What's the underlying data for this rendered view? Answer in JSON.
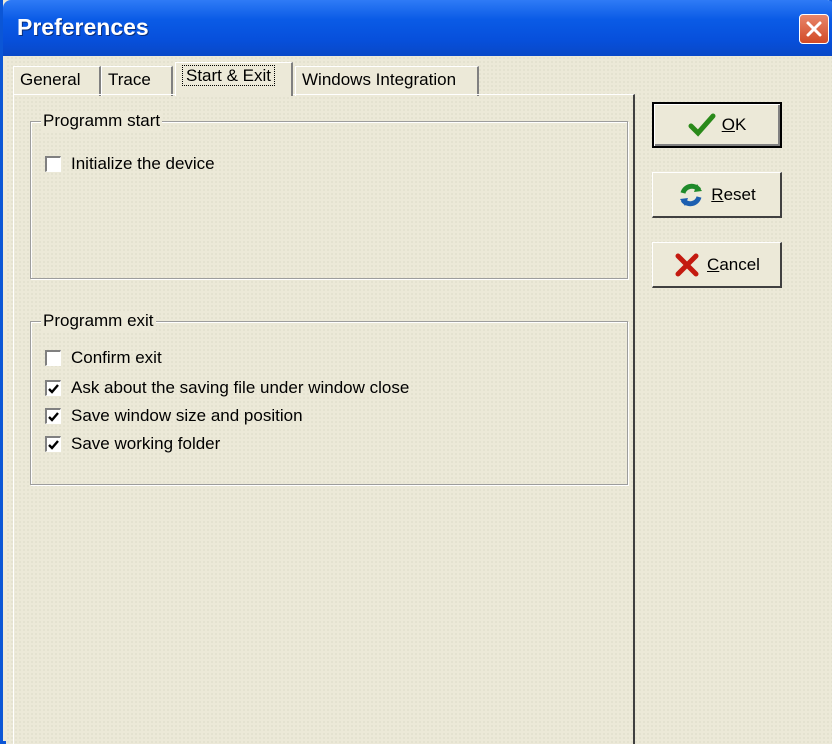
{
  "window": {
    "title": "Preferences"
  },
  "tabs": [
    {
      "label": "General"
    },
    {
      "label": "Trace"
    },
    {
      "label": "Start & Exit"
    },
    {
      "label": "Windows Integration"
    }
  ],
  "groups": {
    "start": {
      "title": "Programm start",
      "items": [
        {
          "label": "Initialize the device",
          "checked": false
        }
      ]
    },
    "exit": {
      "title": "Programm exit",
      "items": [
        {
          "label": "Confirm exit",
          "checked": false
        },
        {
          "label": "Ask about the saving file under window close",
          "checked": true
        },
        {
          "label": "Save window size and position",
          "checked": true
        },
        {
          "label": "Save working folder",
          "checked": true
        }
      ]
    }
  },
  "buttons": {
    "ok": {
      "label": "OK",
      "mnemonic": "O",
      "rest": "K",
      "icon": "checkmark-icon"
    },
    "reset": {
      "label": "Reset",
      "mnemonic": "R",
      "rest": "eset",
      "icon": "refresh-icon"
    },
    "cancel": {
      "label": "Cancel",
      "mnemonic": "C",
      "rest": "ancel",
      "icon": "x-icon"
    }
  }
}
